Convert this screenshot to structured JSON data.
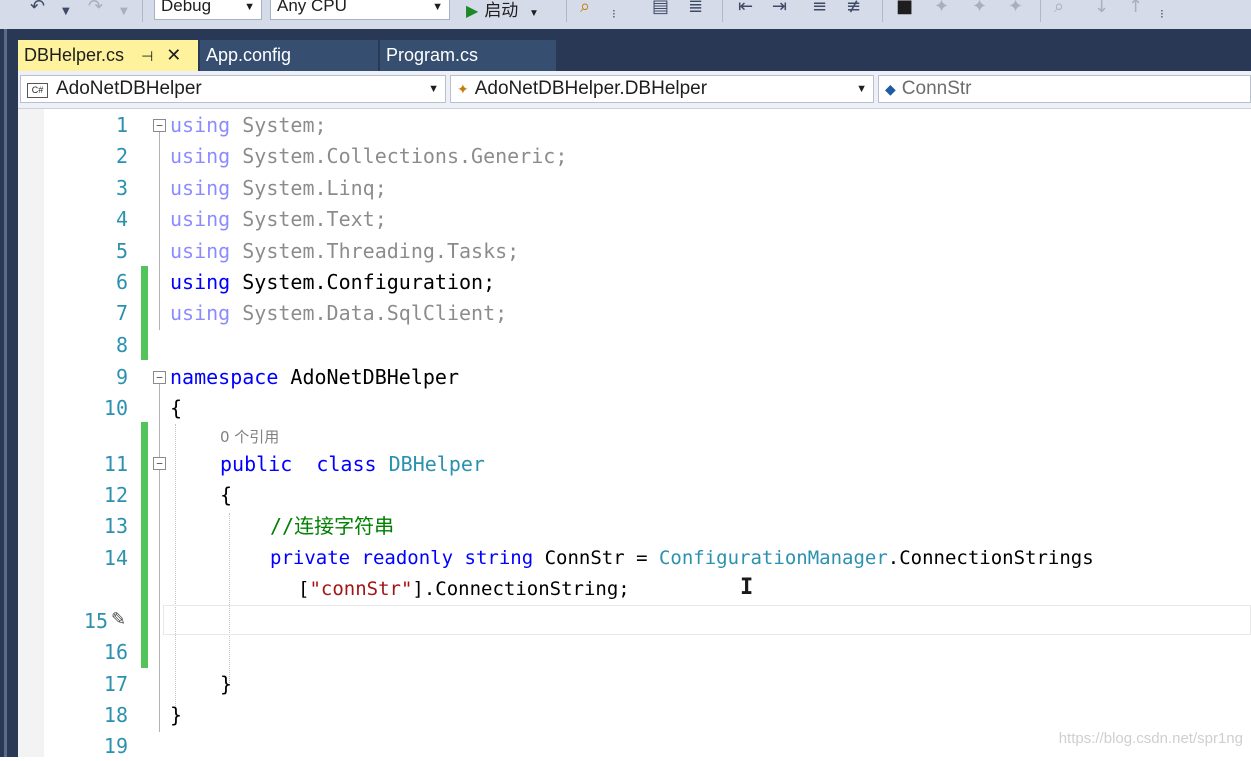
{
  "toolbar": {
    "config_value": "Debug",
    "platform_value": "Any CPU",
    "start_label": "启动"
  },
  "tabs": [
    {
      "label": "DBHelper.cs",
      "active": true
    },
    {
      "label": "App.config",
      "active": false
    },
    {
      "label": "Program.cs",
      "active": false
    }
  ],
  "navbar": {
    "project": "AdoNetDBHelper",
    "type": "AdoNetDBHelper.DBHelper",
    "member": "ConnStr"
  },
  "editor": {
    "line_numbers": [
      "1",
      "2",
      "3",
      "4",
      "5",
      "6",
      "7",
      "8",
      "9",
      "10",
      "11",
      "12",
      "13",
      "14",
      "15",
      "16",
      "17",
      "18",
      "19"
    ],
    "lines": {
      "l1": {
        "kw": "using",
        "rest": " System;"
      },
      "l2": {
        "kw": "using",
        "rest": " System.Collections.Generic;"
      },
      "l3": {
        "kw": "using",
        "rest": " System.Linq;"
      },
      "l4": {
        "kw": "using",
        "rest": " System.Text;"
      },
      "l5": {
        "kw": "using",
        "rest": " System.Threading.Tasks;"
      },
      "l6": {
        "kw": "using",
        "rest": " System.Configuration;"
      },
      "l7": {
        "kw": "using",
        "rest": " System.Data.SqlClient;"
      },
      "l9": {
        "kw": "namespace",
        "rest": " AdoNetDBHelper"
      },
      "l10": {
        "text": "{"
      },
      "codelens": "0 个引用",
      "l11": {
        "kw1": "public",
        "kw2": "class",
        "type": "DBHelper"
      },
      "l12": {
        "text": "{"
      },
      "l13": {
        "comment": "//连接字符串"
      },
      "l14": {
        "kw1": "private",
        "kw2": "readonly",
        "kw3": "string",
        "name": " ConnStr = ",
        "type": "ConfigurationManager",
        "rest": ".ConnectionStrings"
      },
      "l14b": {
        "open": "[",
        "str": "\"connStr\"",
        "rest": "].ConnectionString;"
      },
      "l17": {
        "text": "}"
      },
      "l18": {
        "text": "}"
      }
    }
  },
  "watermark": "https://blog.csdn.net/spr1ng",
  "colors": {
    "keyword": "#0000ff",
    "type": "#2b91af",
    "string": "#a31515",
    "comment": "#008000",
    "line_number": "#2b91af",
    "change_bar": "#52c45b",
    "active_tab": "#fff29d",
    "frame": "#293955"
  }
}
